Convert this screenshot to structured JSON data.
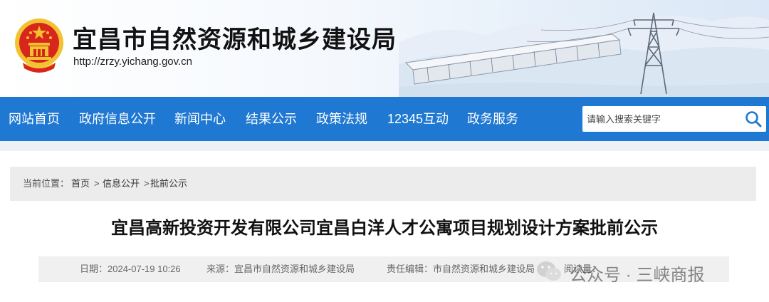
{
  "header": {
    "site_title": "宜昌市自然资源和城乡建设局",
    "site_url": "http://zrzy.yichang.gov.cn",
    "emblem_icon": "national-emblem-icon"
  },
  "nav": {
    "items": [
      {
        "label": "网站首页"
      },
      {
        "label": "政府信息公开"
      },
      {
        "label": "新闻中心"
      },
      {
        "label": "结果公示"
      },
      {
        "label": "政策法规"
      },
      {
        "label": "12345互动"
      },
      {
        "label": "政务服务"
      }
    ],
    "search": {
      "placeholder": "请输入搜索关键字",
      "icon": "search-icon"
    }
  },
  "breadcrumb": {
    "label": "当前位置：",
    "items": [
      {
        "label": "首页"
      },
      {
        "label": "信息公开"
      },
      {
        "label": "批前公示"
      }
    ],
    "separator": ">"
  },
  "article": {
    "title": "宜昌高新投资开发有限公司宜昌白洋人才公寓项目规划设计方案批前公示",
    "date": "日期：2024-07-19 10:26",
    "source": "来源：宜昌市自然资源和城乡建设局",
    "editor": "责任编辑：市自然资源和城乡建设局",
    "views": "阅读量："
  },
  "watermark": {
    "account": "公众号 · 三峡商报"
  },
  "colors": {
    "nav_bg": "#1f78d1",
    "title_text": "#121212",
    "emblem_red": "#d8261c",
    "emblem_gold": "#f2c230"
  }
}
